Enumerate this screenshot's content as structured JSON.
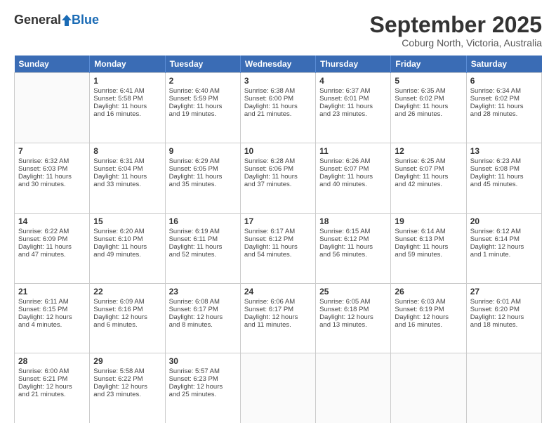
{
  "header": {
    "logo": {
      "general": "General",
      "blue": "Blue"
    },
    "title": "September 2025",
    "location": "Coburg North, Victoria, Australia"
  },
  "days": [
    "Sunday",
    "Monday",
    "Tuesday",
    "Wednesday",
    "Thursday",
    "Friday",
    "Saturday"
  ],
  "weeks": [
    [
      {
        "num": "",
        "info": []
      },
      {
        "num": "1",
        "info": [
          "Sunrise: 6:41 AM",
          "Sunset: 5:58 PM",
          "Daylight: 11 hours",
          "and 16 minutes."
        ]
      },
      {
        "num": "2",
        "info": [
          "Sunrise: 6:40 AM",
          "Sunset: 5:59 PM",
          "Daylight: 11 hours",
          "and 19 minutes."
        ]
      },
      {
        "num": "3",
        "info": [
          "Sunrise: 6:38 AM",
          "Sunset: 6:00 PM",
          "Daylight: 11 hours",
          "and 21 minutes."
        ]
      },
      {
        "num": "4",
        "info": [
          "Sunrise: 6:37 AM",
          "Sunset: 6:01 PM",
          "Daylight: 11 hours",
          "and 23 minutes."
        ]
      },
      {
        "num": "5",
        "info": [
          "Sunrise: 6:35 AM",
          "Sunset: 6:02 PM",
          "Daylight: 11 hours",
          "and 26 minutes."
        ]
      },
      {
        "num": "6",
        "info": [
          "Sunrise: 6:34 AM",
          "Sunset: 6:02 PM",
          "Daylight: 11 hours",
          "and 28 minutes."
        ]
      }
    ],
    [
      {
        "num": "7",
        "info": [
          "Sunrise: 6:32 AM",
          "Sunset: 6:03 PM",
          "Daylight: 11 hours",
          "and 30 minutes."
        ]
      },
      {
        "num": "8",
        "info": [
          "Sunrise: 6:31 AM",
          "Sunset: 6:04 PM",
          "Daylight: 11 hours",
          "and 33 minutes."
        ]
      },
      {
        "num": "9",
        "info": [
          "Sunrise: 6:29 AM",
          "Sunset: 6:05 PM",
          "Daylight: 11 hours",
          "and 35 minutes."
        ]
      },
      {
        "num": "10",
        "info": [
          "Sunrise: 6:28 AM",
          "Sunset: 6:06 PM",
          "Daylight: 11 hours",
          "and 37 minutes."
        ]
      },
      {
        "num": "11",
        "info": [
          "Sunrise: 6:26 AM",
          "Sunset: 6:07 PM",
          "Daylight: 11 hours",
          "and 40 minutes."
        ]
      },
      {
        "num": "12",
        "info": [
          "Sunrise: 6:25 AM",
          "Sunset: 6:07 PM",
          "Daylight: 11 hours",
          "and 42 minutes."
        ]
      },
      {
        "num": "13",
        "info": [
          "Sunrise: 6:23 AM",
          "Sunset: 6:08 PM",
          "Daylight: 11 hours",
          "and 45 minutes."
        ]
      }
    ],
    [
      {
        "num": "14",
        "info": [
          "Sunrise: 6:22 AM",
          "Sunset: 6:09 PM",
          "Daylight: 11 hours",
          "and 47 minutes."
        ]
      },
      {
        "num": "15",
        "info": [
          "Sunrise: 6:20 AM",
          "Sunset: 6:10 PM",
          "Daylight: 11 hours",
          "and 49 minutes."
        ]
      },
      {
        "num": "16",
        "info": [
          "Sunrise: 6:19 AM",
          "Sunset: 6:11 PM",
          "Daylight: 11 hours",
          "and 52 minutes."
        ]
      },
      {
        "num": "17",
        "info": [
          "Sunrise: 6:17 AM",
          "Sunset: 6:12 PM",
          "Daylight: 11 hours",
          "and 54 minutes."
        ]
      },
      {
        "num": "18",
        "info": [
          "Sunrise: 6:15 AM",
          "Sunset: 6:12 PM",
          "Daylight: 11 hours",
          "and 56 minutes."
        ]
      },
      {
        "num": "19",
        "info": [
          "Sunrise: 6:14 AM",
          "Sunset: 6:13 PM",
          "Daylight: 11 hours",
          "and 59 minutes."
        ]
      },
      {
        "num": "20",
        "info": [
          "Sunrise: 6:12 AM",
          "Sunset: 6:14 PM",
          "Daylight: 12 hours",
          "and 1 minute."
        ]
      }
    ],
    [
      {
        "num": "21",
        "info": [
          "Sunrise: 6:11 AM",
          "Sunset: 6:15 PM",
          "Daylight: 12 hours",
          "and 4 minutes."
        ]
      },
      {
        "num": "22",
        "info": [
          "Sunrise: 6:09 AM",
          "Sunset: 6:16 PM",
          "Daylight: 12 hours",
          "and 6 minutes."
        ]
      },
      {
        "num": "23",
        "info": [
          "Sunrise: 6:08 AM",
          "Sunset: 6:17 PM",
          "Daylight: 12 hours",
          "and 8 minutes."
        ]
      },
      {
        "num": "24",
        "info": [
          "Sunrise: 6:06 AM",
          "Sunset: 6:17 PM",
          "Daylight: 12 hours",
          "and 11 minutes."
        ]
      },
      {
        "num": "25",
        "info": [
          "Sunrise: 6:05 AM",
          "Sunset: 6:18 PM",
          "Daylight: 12 hours",
          "and 13 minutes."
        ]
      },
      {
        "num": "26",
        "info": [
          "Sunrise: 6:03 AM",
          "Sunset: 6:19 PM",
          "Daylight: 12 hours",
          "and 16 minutes."
        ]
      },
      {
        "num": "27",
        "info": [
          "Sunrise: 6:01 AM",
          "Sunset: 6:20 PM",
          "Daylight: 12 hours",
          "and 18 minutes."
        ]
      }
    ],
    [
      {
        "num": "28",
        "info": [
          "Sunrise: 6:00 AM",
          "Sunset: 6:21 PM",
          "Daylight: 12 hours",
          "and 21 minutes."
        ]
      },
      {
        "num": "29",
        "info": [
          "Sunrise: 5:58 AM",
          "Sunset: 6:22 PM",
          "Daylight: 12 hours",
          "and 23 minutes."
        ]
      },
      {
        "num": "30",
        "info": [
          "Sunrise: 5:57 AM",
          "Sunset: 6:23 PM",
          "Daylight: 12 hours",
          "and 25 minutes."
        ]
      },
      {
        "num": "",
        "info": []
      },
      {
        "num": "",
        "info": []
      },
      {
        "num": "",
        "info": []
      },
      {
        "num": "",
        "info": []
      }
    ]
  ]
}
